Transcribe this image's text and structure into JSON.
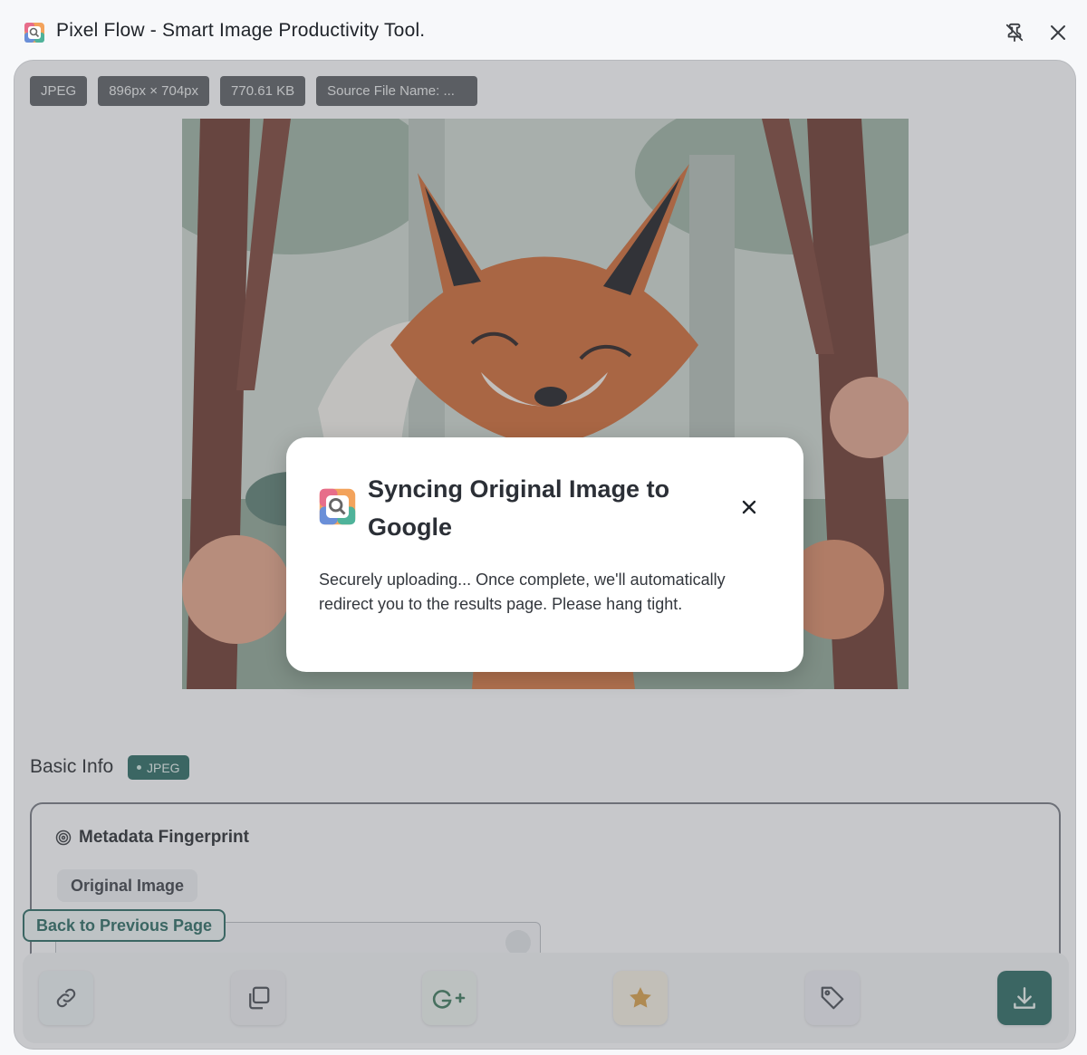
{
  "window": {
    "title": "Pixel Flow - Smart Image Productivity Tool.",
    "icon": "app-logo-icon",
    "controls": {
      "pin_icon": "pin-off-icon",
      "close_icon": "close-icon"
    }
  },
  "image_info": {
    "chips": [
      "JPEG",
      "896px × 704px",
      "770.61 KB",
      "Source File Name: ..."
    ]
  },
  "preview": {
    "subject": "fox-illustration"
  },
  "basic_info": {
    "title": "Basic Info",
    "format_badge": "JPEG"
  },
  "metadata": {
    "heading": "Metadata Fingerprint",
    "heading_icon": "fingerprint-icon",
    "tab": "Original Image"
  },
  "back_button": "Back to Previous Page",
  "toolbar": {
    "buttons": [
      {
        "name": "copy-link",
        "icon": "link-icon"
      },
      {
        "name": "copy-image",
        "icon": "copy-icon"
      },
      {
        "name": "google-lens",
        "icon": "google-plus-icon"
      },
      {
        "name": "favorite",
        "icon": "star-icon"
      },
      {
        "name": "tag",
        "icon": "tag-icon"
      },
      {
        "name": "download",
        "icon": "download-icon"
      }
    ]
  },
  "modal": {
    "title": "Syncing Original Image to Google",
    "body": "Securely uploading... Once complete, we'll automatically redirect you to the results page. Please hang tight.",
    "close_icon": "close-icon"
  },
  "colors": {
    "accent": "#2d6b63",
    "chip_bg": "#5c5f63",
    "star": "#e8b04a"
  }
}
